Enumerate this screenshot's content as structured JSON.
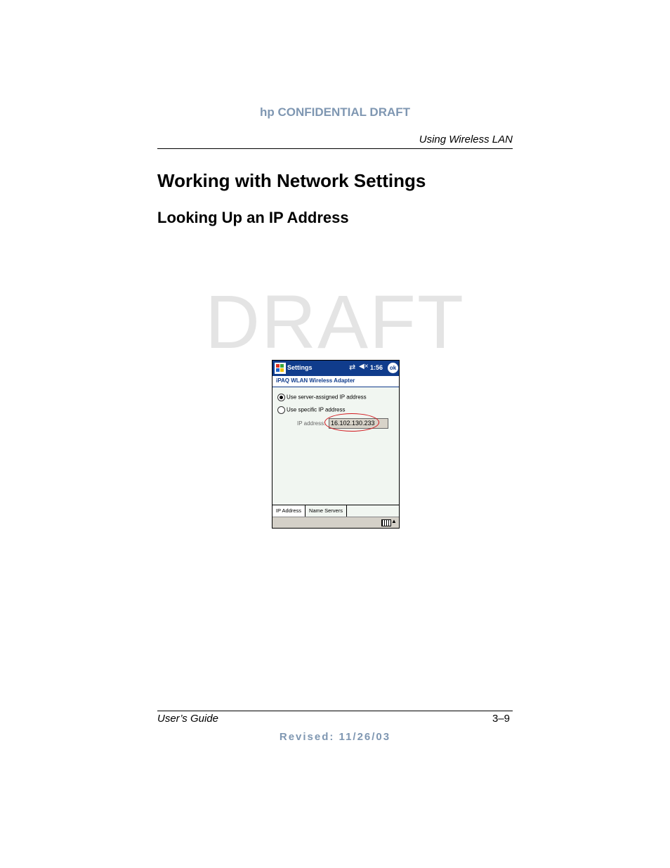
{
  "header": {
    "confidential": "hp CONFIDENTIAL DRAFT",
    "running_head": "Using Wireless LAN"
  },
  "headings": {
    "h1": "Working with Network Settings",
    "h2": "Looking Up an IP Address"
  },
  "watermark": "DRAFT",
  "screenshot": {
    "title": "Settings",
    "time": "1:56",
    "ok_label": "ok",
    "adapter_name": "iPAQ WLAN Wireless Adapter",
    "options": [
      {
        "label": "Use server-assigned IP address",
        "selected": true
      },
      {
        "label": "Use specific IP address",
        "selected": false
      }
    ],
    "ip_label": "IP address:",
    "ip_value": "16.102.130.233",
    "tabs": [
      "IP Address",
      "Name Servers"
    ],
    "highlight_color": "#d2161c",
    "titlebar_color": "#103c8c"
  },
  "footer": {
    "left": "User’s Guide",
    "right": "3–9",
    "revised": "Revised: 11/26/03"
  }
}
